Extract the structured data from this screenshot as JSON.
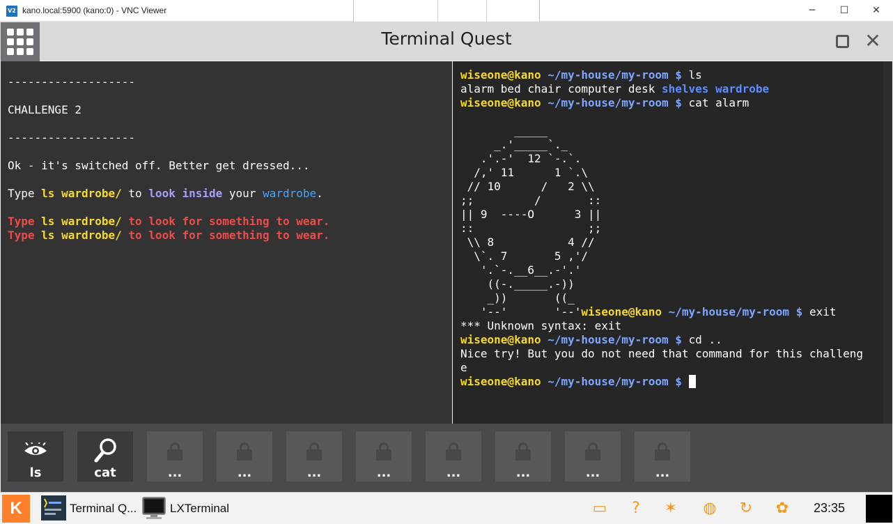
{
  "vnc": {
    "title": "kano.local:5900 (kano:0) - VNC Viewer",
    "logo": "V2",
    "minimize": "─",
    "maximize": "☐",
    "close": "✕"
  },
  "app": {
    "title": "Terminal Quest",
    "close_glyph": "✕"
  },
  "story": {
    "divider": "-------------------",
    "challenge": "CHALLENGE 2",
    "line1": "Ok - it's switched off. Better get dressed...",
    "line2": {
      "t1": "Type ",
      "cmd": "ls wardrobe/",
      "t2": " to ",
      "look": "look",
      "sp": " ",
      "inside": "inside",
      "t3": " your ",
      "wardrobe": "wardrobe",
      "t4": "."
    },
    "hint": {
      "t1": "Type ",
      "cmd": "ls wardrobe/",
      "t2": " to look for something to wear."
    }
  },
  "terminal": {
    "prompt_user": "wiseone@kano",
    "prompt_path": "~/my-house/my-room",
    "prompt_sign": "$",
    "cmd1": "ls",
    "ls_plain": "alarm bed chair computer desk ",
    "ls_dir1": "shelves",
    "ls_dir2": "wardrobe",
    "cmd2": "cat alarm",
    "ascii_art": "        _____\n     _.'_____`._\n   .'.-'  12 `-.`.\n  /,' 11      1 `.\\\n // 10      /   2 \\\\\n;;         /       ::\n|| 9  ----O      3 ||\n::                 ;;\n \\\\ 8           4 //\n  \\`. 7       5 ,'/\n   '.`-.__6__.-'.'\n    ((-._____.-))\n    _))       ((_\n   '--'       '--'",
    "cmd3": "exit",
    "out3": "*** Unknown syntax: exit",
    "cmd4": "cd ..",
    "out4a": "Nice try! But you do not need that command for this challeng",
    "out4b": "e"
  },
  "commands": [
    {
      "label": "ls",
      "icon": "eye-icon",
      "locked": false
    },
    {
      "label": "cat",
      "icon": "magnifier-icon",
      "locked": false
    },
    {
      "label": "...",
      "icon": "lock-icon",
      "locked": true
    },
    {
      "label": "...",
      "icon": "lock-icon",
      "locked": true
    },
    {
      "label": "...",
      "icon": "lock-icon",
      "locked": true
    },
    {
      "label": "...",
      "icon": "lock-icon",
      "locked": true
    },
    {
      "label": "...",
      "icon": "lock-icon",
      "locked": true
    },
    {
      "label": "...",
      "icon": "lock-icon",
      "locked": true
    },
    {
      "label": "...",
      "icon": "lock-icon",
      "locked": true
    },
    {
      "label": "...",
      "icon": "lock-icon",
      "locked": true
    }
  ],
  "taskbar": {
    "start": "K",
    "task1": "Terminal Q...",
    "task2": "LXTerminal",
    "clock": "23:35",
    "tray_icons": [
      "notification-icon",
      "help-icon",
      "people-icon",
      "network-icon",
      "updates-icon",
      "settings-icon"
    ],
    "tray_glyphs": [
      "▭",
      "?",
      "✶",
      "◍",
      "↻",
      "✿"
    ]
  },
  "colors": {
    "prompt_user": "#f6d92d",
    "prompt_path": "#7ea6ff",
    "directory": "#5c8dff",
    "hint": "#ee4c4c",
    "accent": "#ff7f2a"
  }
}
